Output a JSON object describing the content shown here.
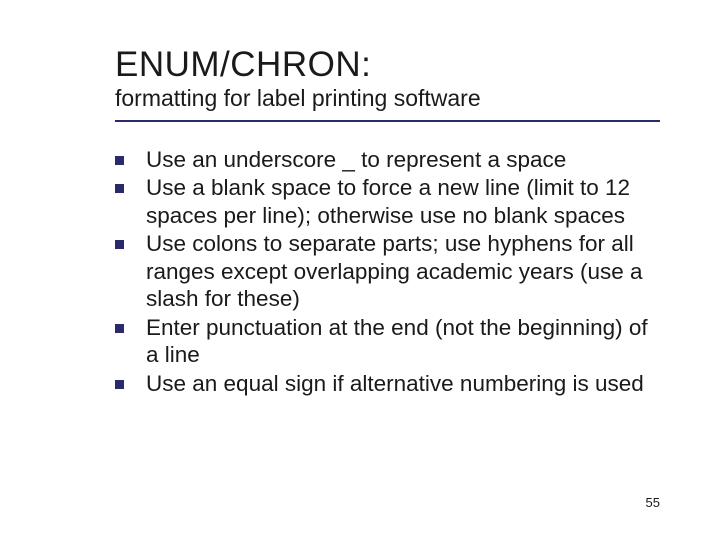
{
  "title": "ENUM/CHRON:",
  "subtitle": "formatting for label printing software",
  "bullets": [
    "Use an underscore _ to represent a space",
    "Use a blank space to force a new line (limit to 12 spaces per line); otherwise use no blank spaces",
    "Use colons to separate parts; use hyphens for all ranges except overlapping academic years (use a slash for these)",
    "Enter punctuation at the end (not the beginning) of a line",
    "Use an equal sign if alternative numbering is used"
  ],
  "page_number": "55"
}
